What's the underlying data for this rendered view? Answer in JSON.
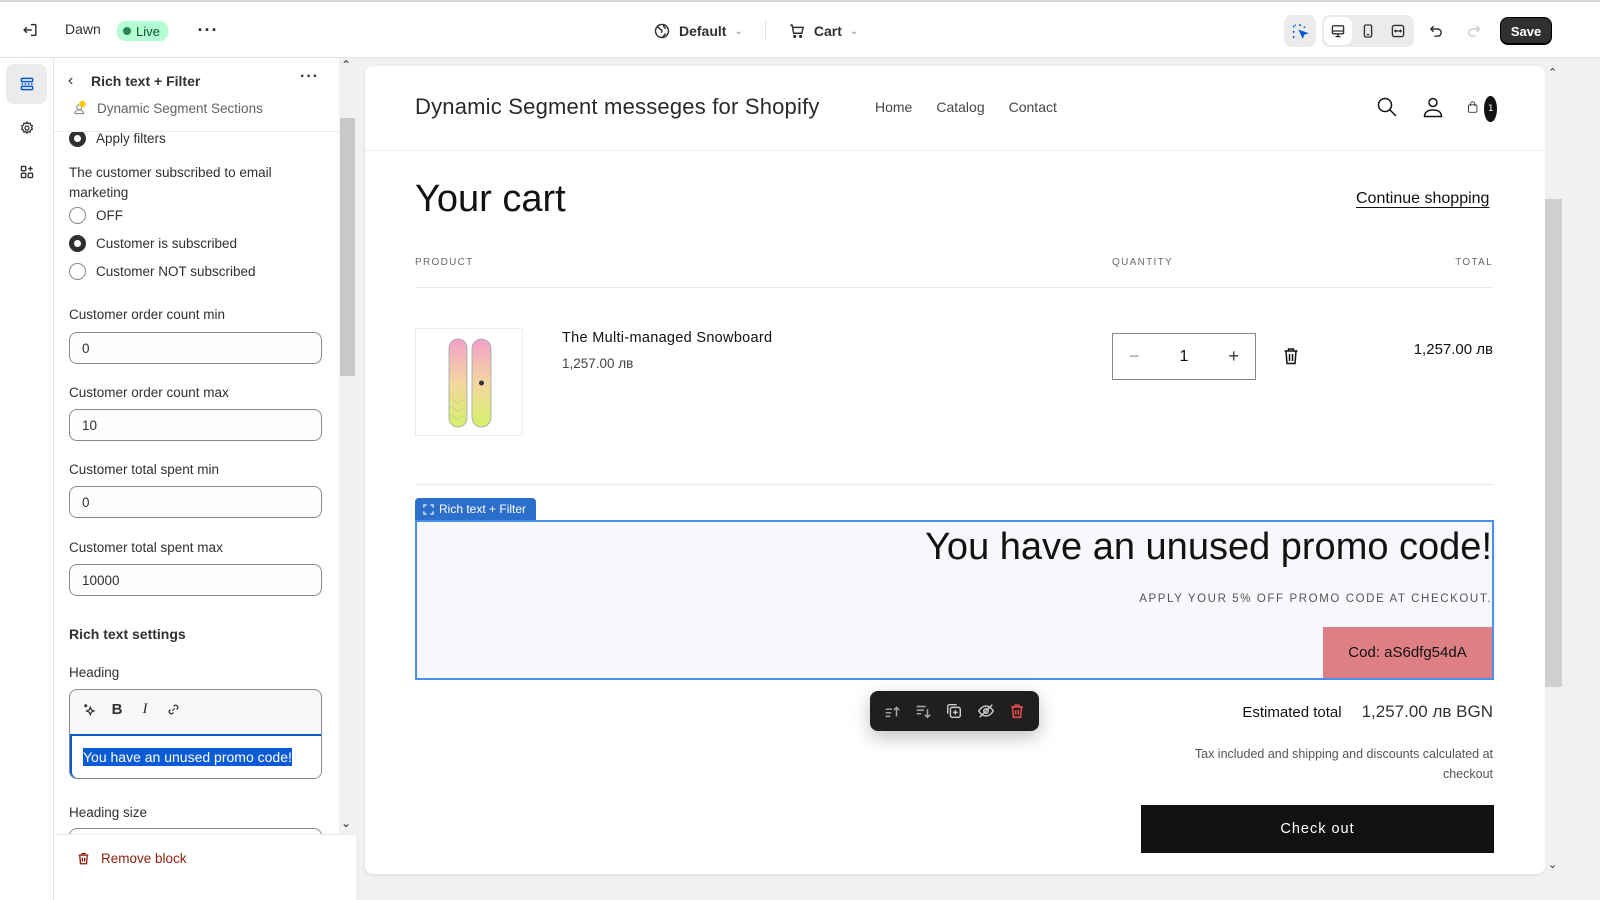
{
  "topbar": {
    "theme_name": "Dawn",
    "status_badge": "Live",
    "template_selector": "Default",
    "page_selector": "Cart",
    "save_label": "Save",
    "icons": [
      "exit-icon",
      "more-icon",
      "globe-icon",
      "cart-icon",
      "inspector-icon",
      "desktop-icon",
      "mobile-icon",
      "fullwidth-icon",
      "undo-icon",
      "redo-icon"
    ]
  },
  "rail": {
    "items": [
      {
        "name": "sections",
        "icon": "sections-icon",
        "active": true
      },
      {
        "name": "theme-settings",
        "icon": "gear-icon",
        "active": false
      },
      {
        "name": "app-embeds",
        "icon": "apps-icon",
        "active": false
      }
    ]
  },
  "panel": {
    "title": "Rich text + Filter",
    "subtitle": "Dynamic Segment Sections",
    "apply_filters_label": "Apply filters",
    "email_marketing": {
      "label": "The customer subscribed to email marketing",
      "options": [
        {
          "label": "OFF",
          "selected": false
        },
        {
          "label": "Customer is subscribed",
          "selected": true
        },
        {
          "label": "Customer NOT subscribed",
          "selected": false
        }
      ]
    },
    "fields": [
      {
        "label": "Customer order count min",
        "value": "0"
      },
      {
        "label": "Customer order count max",
        "value": "10"
      },
      {
        "label": "Customer total spent min",
        "value": "0"
      },
      {
        "label": "Customer total spent max",
        "value": "10000"
      }
    ],
    "rich_text_settings_label": "Rich text settings",
    "heading_label": "Heading",
    "heading_value": "You have an unused promo code!",
    "heading_size_label": "Heading size",
    "remove_block_label": "Remove block"
  },
  "preview": {
    "site_title": "Dynamic Segment messeges for Shopify",
    "nav": [
      "Home",
      "Catalog",
      "Contact"
    ],
    "cart_count": "1",
    "cart_title": "Your cart",
    "continue_shopping": "Continue shopping",
    "columns": {
      "product": "PRODUCT",
      "quantity": "QUANTITY",
      "total": "TOTAL"
    },
    "items": [
      {
        "name": "The Multi-managed Snowboard",
        "price": "1,257.00 лв",
        "quantity": "1",
        "total": "1,257.00 лв"
      }
    ],
    "block_tab_label": "Rich text + Filter",
    "promo_heading": "You have an unused promo code!",
    "promo_subtext": "APPLY YOUR 5% OFF PROMO CODE AT CHECKOUT.",
    "promo_code": "Cod: aS6dfg54dA",
    "promo_code_color": "#dd7f84",
    "estimated_total_label": "Estimated total",
    "estimated_total_value": "1,257.00 лв BGN",
    "tax_note": "Tax included and shipping and discounts calculated at checkout",
    "checkout_label": "Check out"
  }
}
